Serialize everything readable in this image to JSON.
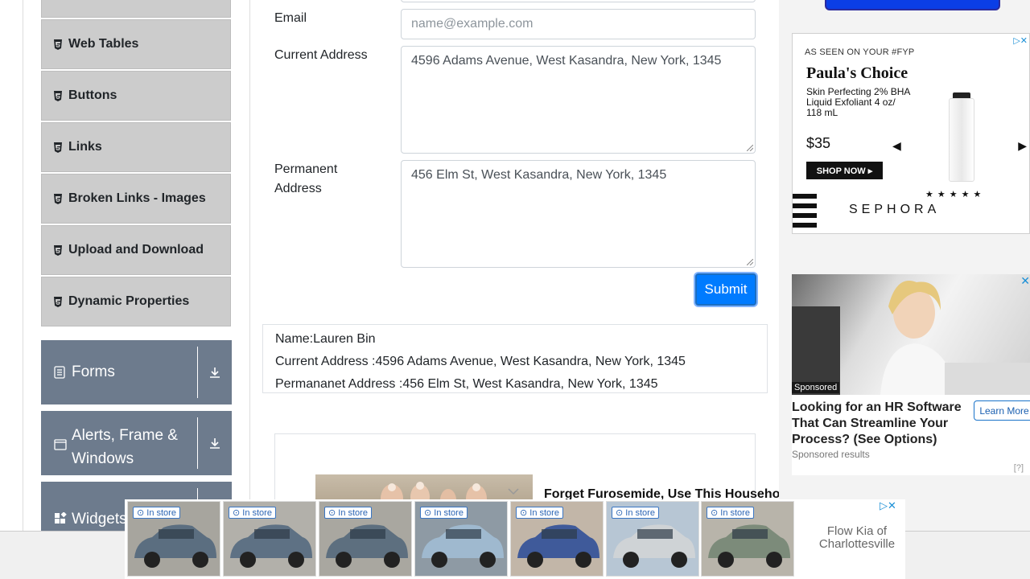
{
  "sidebar": {
    "items": [
      {
        "label": "Web Tables"
      },
      {
        "label": "Buttons"
      },
      {
        "label": "Links"
      },
      {
        "label": "Broken Links - Images"
      },
      {
        "label": "Upload and Download"
      },
      {
        "label": "Dynamic Properties"
      }
    ],
    "groups": [
      {
        "label": "Forms"
      },
      {
        "label": "Alerts, Frame & Windows"
      },
      {
        "label": "Widgets"
      }
    ]
  },
  "form": {
    "email_label": "Email",
    "email_placeholder": "name@example.com",
    "current_address_label": "Current Address",
    "current_address_value": "4596 Adams Avenue, West Kasandra, New York, 1345",
    "permanent_address_label": "Permanent Address",
    "permanent_address_value": "456 Elm St, West Kasandra, New York, 1345",
    "submit_label": "Submit"
  },
  "output": {
    "name": "Name:Lauren Bin",
    "current_address": "Current Address :4596 Adams Avenue, West Kasandra, New York, 1345",
    "permanent_address": "Permananet Address :456 Elm St, West Kasandra, New York, 1345"
  },
  "inline_ad": {
    "headline": "Forget Furosemide, Use This Househo"
  },
  "right_ads": {
    "paula": {
      "tag": "AS SEEN ON YOUR #FYP",
      "brand": "Paula's Choice",
      "desc": "Skin Perfecting 2% BHA Liquid Exfoliant 4 oz/ 118 mL",
      "price": "$35",
      "shop": "SHOP NOW ▸",
      "stars": "★★★★★",
      "sephora": "SEPHORA"
    },
    "hr": {
      "sponsored_tag": "Sponsored",
      "title": "Looking for an HR Software That Can Streamline Your Process? (See Options)",
      "learn_more": "Learn More",
      "results": "Sponsored results",
      "help": "[?]"
    }
  },
  "bottom_ad": {
    "badge": "In store",
    "car_count": 7,
    "dealer": "Flow Kia of Charlottesville"
  },
  "colors": {
    "primary": "#007bff",
    "group_header": "#6d7b8d",
    "menu_item_bg": "#cccccc"
  }
}
